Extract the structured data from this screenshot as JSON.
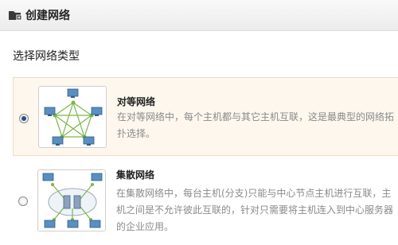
{
  "window": {
    "title": "创建网络",
    "icon": "network-folder-icon"
  },
  "section_title": "选择网络类型",
  "options": [
    {
      "name": "对等网络",
      "selected": true,
      "icon": "peer-to-peer-network-diagram",
      "desc_lines": [
        "在对等网络中，每个主机都与其它主机互联，这是最典型的网络拓",
        "扑选择。"
      ]
    },
    {
      "name": "集散网络",
      "selected": false,
      "icon": "hub-network-diagram",
      "desc_lines": [
        "在集散网络中，每台主机(分支)只能与中心节点主机进行互联，主",
        "机之间是不允许彼此互联的，针对只需要将主机连入到中心服务器",
        "的企业应用。"
      ]
    }
  ],
  "colors": {
    "selected_bg": "#fdf7ee",
    "link_green": "#7ab648",
    "title_bg": "#ececec"
  }
}
